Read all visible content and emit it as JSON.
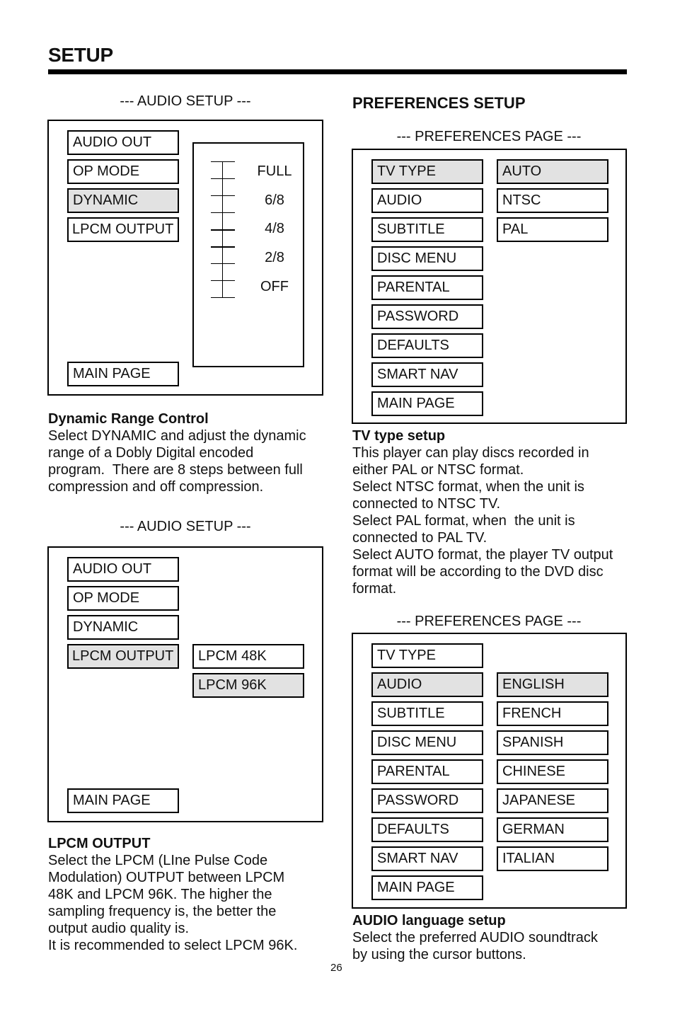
{
  "page": {
    "title": "SETUP",
    "page_number": "26"
  },
  "audio_setup_1": {
    "caption": "--- AUDIO SETUP ---",
    "menu": [
      {
        "label": "AUDIO OUT",
        "selected": false
      },
      {
        "label": "OP MODE",
        "selected": false
      },
      {
        "label": "DYNAMIC",
        "selected": true
      },
      {
        "label": "LPCM OUTPUT",
        "selected": false
      }
    ],
    "main_page": "MAIN PAGE",
    "slider": {
      "labels": [
        "FULL",
        "6/8",
        "4/8",
        "2/8",
        "OFF"
      ],
      "steps": 8,
      "current_level": "4/8"
    }
  },
  "dynamic_desc": {
    "heading": "Dynamic Range Control",
    "lines": [
      "Select DYNAMIC and adjust the dynamic",
      "range of a Dobly Digital encoded",
      "program.  There are 8 steps between full",
      "compression and off compression."
    ]
  },
  "audio_setup_2": {
    "caption": "--- AUDIO SETUP ---",
    "menu": [
      {
        "label": "AUDIO OUT",
        "selected": false
      },
      {
        "label": "OP MODE",
        "selected": false
      },
      {
        "label": "DYNAMIC",
        "selected": false
      },
      {
        "label": "LPCM OUTPUT",
        "selected": true
      }
    ],
    "options": [
      {
        "label": "LPCM 48K",
        "selected": false
      },
      {
        "label": "LPCM 96K",
        "selected": true
      }
    ],
    "main_page": "MAIN PAGE"
  },
  "lpcm_desc": {
    "heading": "LPCM OUTPUT",
    "lines": [
      "Select the LPCM (LIne Pulse Code",
      "Modulation) OUTPUT between LPCM",
      "48K and LPCM 96K. The higher the",
      "sampling frequency is, the better the",
      "output audio quality is.",
      "It is recommended to select LPCM 96K."
    ]
  },
  "preferences": {
    "heading": "PREFERENCES SETUP",
    "page1": {
      "caption": "--- PREFERENCES PAGE ---",
      "menu": [
        {
          "label": "TV TYPE",
          "selected": true
        },
        {
          "label": "AUDIO",
          "selected": false
        },
        {
          "label": "SUBTITLE",
          "selected": false
        },
        {
          "label": "DISC MENU",
          "selected": false
        },
        {
          "label": "PARENTAL",
          "selected": false
        },
        {
          "label": "PASSWORD",
          "selected": false
        },
        {
          "label": "DEFAULTS",
          "selected": false
        },
        {
          "label": "SMART NAV",
          "selected": false
        },
        {
          "label": "MAIN PAGE",
          "selected": false
        }
      ],
      "options": [
        {
          "label": "AUTO",
          "selected": true
        },
        {
          "label": "NTSC",
          "selected": false
        },
        {
          "label": "PAL",
          "selected": false
        }
      ]
    },
    "page2": {
      "caption": "--- PREFERENCES PAGE ---",
      "menu": [
        {
          "label": "TV TYPE",
          "selected": false
        },
        {
          "label": "AUDIO",
          "selected": true
        },
        {
          "label": "SUBTITLE",
          "selected": false
        },
        {
          "label": "DISC MENU",
          "selected": false
        },
        {
          "label": "PARENTAL",
          "selected": false
        },
        {
          "label": "PASSWORD",
          "selected": false
        },
        {
          "label": "DEFAULTS",
          "selected": false
        },
        {
          "label": "SMART NAV",
          "selected": false
        },
        {
          "label": "MAIN PAGE",
          "selected": false
        }
      ],
      "options": [
        {
          "label": "ENGLISH",
          "selected": true
        },
        {
          "label": "FRENCH",
          "selected": false
        },
        {
          "label": "SPANISH",
          "selected": false
        },
        {
          "label": "CHINESE",
          "selected": false
        },
        {
          "label": "JAPANESE",
          "selected": false
        },
        {
          "label": "GERMAN",
          "selected": false
        },
        {
          "label": "ITALIAN",
          "selected": false
        }
      ]
    }
  },
  "tv_desc": {
    "heading": "TV type setup",
    "lines": [
      "This player can play discs recorded in",
      "either PAL or NTSC format.",
      "Select NTSC format, when the unit is",
      "connected to NTSC TV.",
      "Select PAL format, when  the unit is",
      "connected to PAL TV.",
      "Select AUTO format, the player TV output",
      "format will be according to the DVD disc",
      "format."
    ]
  },
  "audio_lang_desc": {
    "heading": "AUDIO language setup",
    "lines": [
      "Select the preferred AUDIO soundtrack",
      "by using the cursor buttons."
    ]
  },
  "colors": {
    "highlight": "#e2e2e2",
    "border": "#000000"
  }
}
